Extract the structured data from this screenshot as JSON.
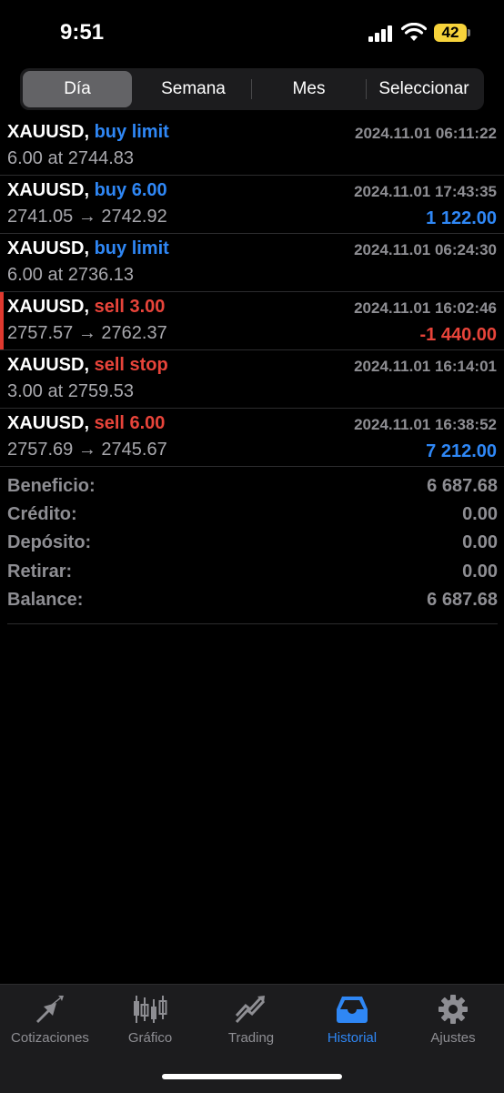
{
  "status": {
    "time": "9:51",
    "battery": "42"
  },
  "segments": [
    {
      "label": "Día",
      "active": true
    },
    {
      "label": "Semana",
      "active": false
    },
    {
      "label": "Mes",
      "active": false
    },
    {
      "label": "Seleccionar",
      "active": false
    }
  ],
  "orders": [
    {
      "symbol": "XAUUSD,",
      "type": "buy limit",
      "side": "buy",
      "time": "2024.11.01 06:11:22",
      "detail": "6.00 at 2744.83",
      "profit": ""
    },
    {
      "symbol": "XAUUSD,",
      "type": "buy 6.00",
      "side": "buy",
      "time": "2024.11.01 17:43:35",
      "detail": "2741.05 → 2742.92",
      "profit": "1 122.00"
    },
    {
      "symbol": "XAUUSD,",
      "type": "buy limit",
      "side": "buy",
      "time": "2024.11.01 06:24:30",
      "detail": "6.00 at 2736.13",
      "profit": ""
    },
    {
      "symbol": "XAUUSD,",
      "type": "sell 3.00",
      "side": "sell",
      "time": "2024.11.01 16:02:46",
      "detail": "2757.57 → 2762.37",
      "profit": "-1 440.00"
    },
    {
      "symbol": "XAUUSD,",
      "type": "sell stop",
      "side": "sell",
      "time": "2024.11.01 16:14:01",
      "detail": "3.00 at 2759.53",
      "profit": ""
    },
    {
      "symbol": "XAUUSD,",
      "type": "sell 6.00",
      "side": "sell",
      "time": "2024.11.01 16:38:52",
      "detail": "2757.69 → 2745.67",
      "profit": "7 212.00"
    }
  ],
  "summary": [
    {
      "label": "Beneficio:",
      "value": "6 687.68"
    },
    {
      "label": "Crédito:",
      "value": "0.00"
    },
    {
      "label": "Depósito:",
      "value": "0.00"
    },
    {
      "label": "Retirar:",
      "value": "0.00"
    },
    {
      "label": "Balance:",
      "value": "6 687.68"
    }
  ],
  "tabs": [
    {
      "label": "Cotizaciones",
      "icon": "quotes-arrows-icon",
      "active": false
    },
    {
      "label": "Gráfico",
      "icon": "candlestick-chart-icon",
      "active": false
    },
    {
      "label": "Trading",
      "icon": "trading-trend-icon",
      "active": false
    },
    {
      "label": "Historial",
      "icon": "history-inbox-icon",
      "active": true
    },
    {
      "label": "Ajustes",
      "icon": "gear-icon",
      "active": false
    }
  ],
  "colors": {
    "buy": "#2f87f5",
    "sell": "#e8443a",
    "accent": "#2f87f5",
    "muted": "#8e8e93"
  }
}
